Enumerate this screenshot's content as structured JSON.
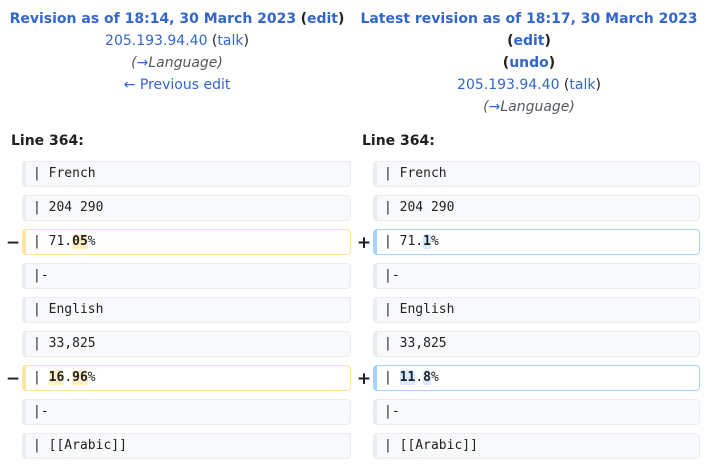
{
  "left_header": {
    "title": "Revision as of 18:14, 30 March 2023",
    "edit": "edit",
    "user": "205.193.94.40",
    "talk": "talk",
    "summary_arrow": "→",
    "summary": "Language",
    "prev_edit": "← Previous edit"
  },
  "right_header": {
    "title": "Latest revision as of 18:17, 30 March 2023",
    "edit": "edit",
    "undo": "undo",
    "user": "205.193.94.40",
    "talk": "talk",
    "summary_arrow": "→",
    "summary": "Language"
  },
  "line_left": "Line 364:",
  "line_right": "Line 364:",
  "markers": {
    "minus": "−",
    "plus": "+"
  },
  "rows": [
    {
      "left": "| French",
      "right": "| French"
    },
    {
      "left": "| 204 290",
      "right": "| 204 290"
    },
    {
      "left_parts": [
        "| 71.",
        "05",
        "%"
      ],
      "right_parts": [
        "| 71.",
        "1",
        "%"
      ]
    },
    {
      "left": "|-",
      "right": "|-"
    },
    {
      "left": "| English",
      "right": "| English"
    },
    {
      "left": "| 33,825",
      "right": "| 33,825"
    },
    {
      "left_parts": [
        "| ",
        "16",
        ".",
        "96",
        "%"
      ],
      "right_parts": [
        "| ",
        "11",
        ".",
        "8",
        "%"
      ]
    },
    {
      "left": "|-",
      "right": "|-"
    },
    {
      "left": "| [[Arabic]]",
      "right": "| [[Arabic]]"
    }
  ]
}
